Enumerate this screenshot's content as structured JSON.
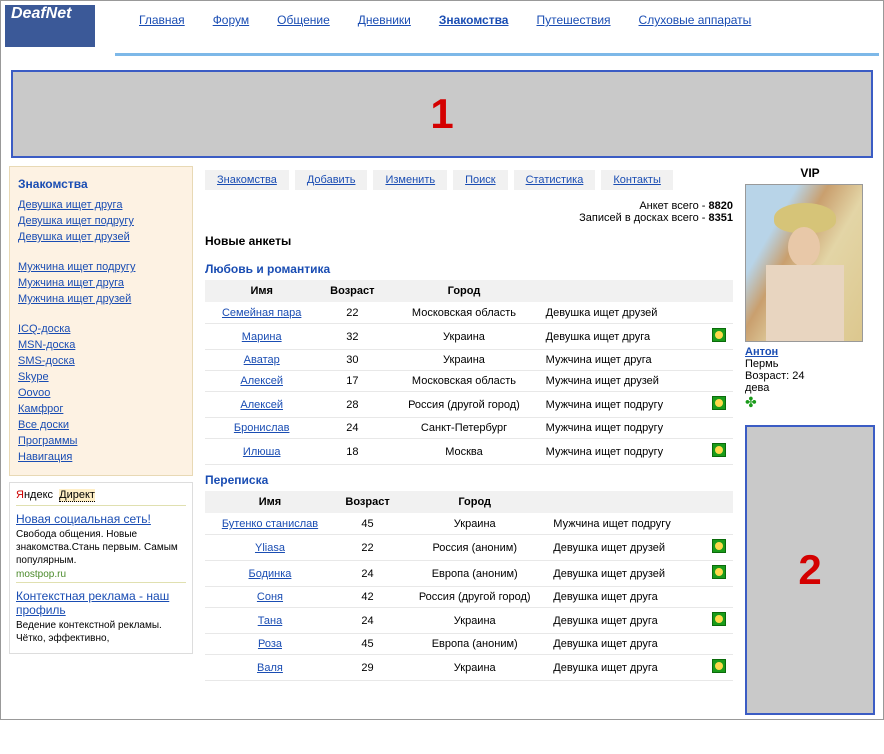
{
  "logo": "DeafNet",
  "topnav": [
    "Главная",
    "Форум",
    "Общение",
    "Дневники",
    "Знакомства",
    "Путешествия",
    "Слуховые аппараты"
  ],
  "topnav_active": 4,
  "banner1": "1",
  "banner2": "2",
  "left": {
    "title": "Знакомства",
    "group1": [
      "Девушка ищет друга",
      "Девушка ищет подругу",
      "Девушка ищет друзей"
    ],
    "group2": [
      "Мужчина ищет подругу",
      "Мужчина ищет друга",
      "Мужчина ищет друзей"
    ],
    "group3": [
      "ICQ-доска",
      "MSN-доска",
      "SMS-доска",
      "Skype",
      "Oovoo",
      "Камфрог",
      "Все доски",
      "Программы",
      "Навигация"
    ]
  },
  "yandex": {
    "brand_red": "Я",
    "brand_rest": "ндекс",
    "direct": "Директ",
    "ads": [
      {
        "title": "Новая социальная сеть!",
        "desc": "Свобода общения. Новые знакомства.Стань первым. Самым популярным.",
        "dom": "mostpop.ru"
      },
      {
        "title": "Контекстная реклама - наш профиль",
        "desc": "Ведение контекстной рекламы. Чётко, эффективно,",
        "dom": ""
      }
    ]
  },
  "subnav": [
    "Знакомства",
    "Добавить",
    "Изменить",
    "Поиск",
    "Статистика",
    "Контакты"
  ],
  "stats": {
    "l1_label": "Анкет всего - ",
    "l1_val": "8820",
    "l2_label": "Записей в досках всего - ",
    "l2_val": "8351"
  },
  "section_new": "Новые анкеты",
  "section_love": "Любовь и романтика",
  "section_corr": "Переписка",
  "th": {
    "name": "Имя",
    "age": "Возраст",
    "city": "Город"
  },
  "love_rows": [
    {
      "name": "Семейная пара",
      "age": "22",
      "city": "Московская область",
      "cat": "Девушка ищет друзей",
      "photo": false
    },
    {
      "name": "Марина",
      "age": "32",
      "city": "Украина",
      "cat": "Девушка ищет друга",
      "photo": true
    },
    {
      "name": "Аватар",
      "age": "30",
      "city": "Украина",
      "cat": "Мужчина ищет друга",
      "photo": false
    },
    {
      "name": "Алексей",
      "age": "17",
      "city": "Московская область",
      "cat": "Мужчина ищет друзей",
      "photo": false
    },
    {
      "name": "Алексей",
      "age": "28",
      "city": "Россия (другой город)",
      "cat": "Мужчина ищет подругу",
      "photo": true
    },
    {
      "name": "Бронислав",
      "age": "24",
      "city": "Санкт-Петербург",
      "cat": "Мужчина ищет подругу",
      "photo": false
    },
    {
      "name": "Илюша",
      "age": "18",
      "city": "Москва",
      "cat": "Мужчина ищет подругу",
      "photo": true
    }
  ],
  "corr_rows": [
    {
      "name": "Бутенко станислав",
      "age": "45",
      "city": "Украина",
      "cat": "Мужчина ищет подругу",
      "photo": false
    },
    {
      "name": "Yliasa",
      "age": "22",
      "city": "Россия (аноним)",
      "cat": "Девушка ищет друзей",
      "photo": true
    },
    {
      "name": "Бодинка",
      "age": "24",
      "city": "Европа (аноним)",
      "cat": "Девушка ищет друзей",
      "photo": true
    },
    {
      "name": "Соня",
      "age": "42",
      "city": "Россия (другой город)",
      "cat": "Девушка ищет друга",
      "photo": false
    },
    {
      "name": "Тана",
      "age": "24",
      "city": "Украина",
      "cat": "Девушка ищет друга",
      "photo": true
    },
    {
      "name": "Роза",
      "age": "45",
      "city": "Европа (аноним)",
      "cat": "Девушка ищет друга",
      "photo": false
    },
    {
      "name": "Валя",
      "age": "29",
      "city": "Украина",
      "cat": "Девушка ищет друга",
      "photo": true
    }
  ],
  "vip": {
    "label": "VIP",
    "name": "Антон",
    "city": "Пермь",
    "age": "Возраст: 24",
    "zodiac": "дева"
  }
}
